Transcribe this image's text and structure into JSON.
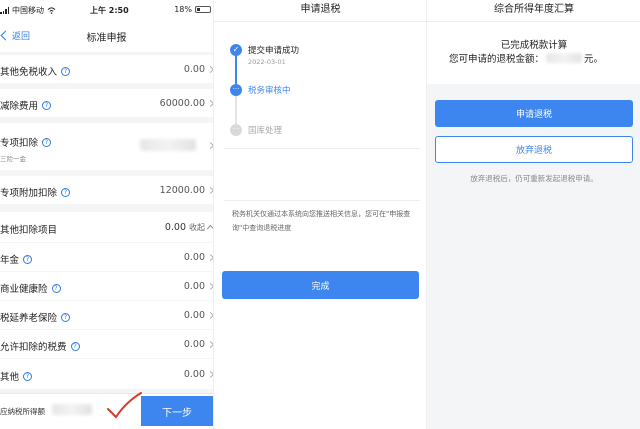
{
  "status_bar": {
    "carrier": "中国移动",
    "time": "上午 2:50",
    "battery": "18%"
  },
  "panel1": {
    "back_label": "返回",
    "title": "标准申报",
    "rows": [
      {
        "label": "其他免税收入",
        "value": "0.00"
      },
      {
        "label": "减除费用",
        "value": "60000.00"
      },
      {
        "label": "专项扣除",
        "sub": "三险一金"
      },
      {
        "label": "专项附加扣除",
        "value": "12000.00"
      },
      {
        "label": "其他扣除项目",
        "value": "0.00",
        "toggle": "收起"
      },
      {
        "label": "年金",
        "value": "0.00"
      },
      {
        "label": "商业健康险",
        "value": "0.00"
      },
      {
        "label": "税延养老保险",
        "value": "0.00"
      },
      {
        "label": "允许扣除的税费",
        "value": "0.00"
      },
      {
        "label": "其他",
        "value": "0.00"
      }
    ],
    "bottom_label": "应纳税所得额",
    "next_button": "下一步"
  },
  "panel2": {
    "title": "申请退税",
    "steps": [
      {
        "label": "提交申请成功",
        "date": "2022-03-01",
        "state": "done"
      },
      {
        "label": "税务审核中",
        "state": "current"
      },
      {
        "label": "国库处理",
        "state": "pending"
      }
    ],
    "notice": "税务机关仅通过本系统向您推送相关信息，您可在\"申报查询\"中查询退税进度",
    "done_button": "完成"
  },
  "panel3": {
    "title": "综合所得年度汇算",
    "line1": "已完成税款计算",
    "line2_prefix": "您可申请的退税金额：",
    "line2_suffix": "元。",
    "apply_button": "申请退税",
    "abandon_button": "放弃退税",
    "hint": "放弃退税后，仍可重新发起退税申请。"
  },
  "colors": {
    "primary": "#3d86f0",
    "check_mark": "#d93a2b"
  }
}
